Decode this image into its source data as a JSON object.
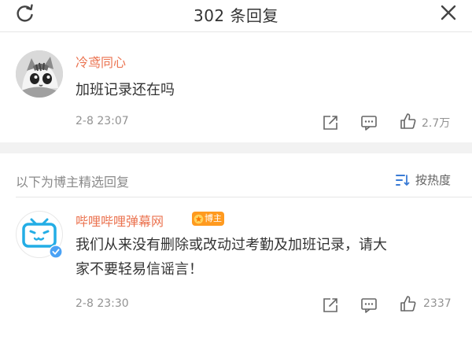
{
  "header": {
    "title": "302 条回复"
  },
  "comments": [
    {
      "username": "冷鸢同心",
      "text": "加班记录还在吗",
      "time": "2-8 23:07",
      "like_count": "2.7万"
    }
  ],
  "featured": {
    "section_label": "以下为博主精选回复",
    "sort_label": "按热度",
    "reply": {
      "username": "哔哩哔哩弹幕网",
      "badge": "博主",
      "text_line1": "我们从来没有删除或改动过考勤及加班记录，请大",
      "text_line2": "家不要轻易信谣言！",
      "time": "2-8 23:30",
      "like_count": "2337"
    }
  },
  "colors": {
    "username": "#eb7350",
    "badge": "#ff9a1f",
    "bilibili_blue": "#23ade5",
    "verified_blue": "#4aa2f5"
  }
}
